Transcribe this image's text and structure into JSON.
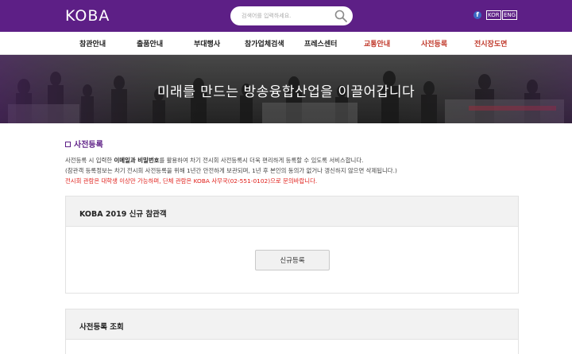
{
  "header": {
    "logo": "KOBA",
    "search_placeholder": "검색어를 입력하세요.",
    "facebook": "f",
    "lang_kor": "KOR",
    "lang_eng": "ENG"
  },
  "nav": [
    {
      "label": "참관안내"
    },
    {
      "label": "출품안내"
    },
    {
      "label": "부대행사"
    },
    {
      "label": "참가업체검색"
    },
    {
      "label": "프레스센터"
    },
    {
      "label": "교통안내"
    },
    {
      "label": "사전등록"
    },
    {
      "label": "전시장도면"
    }
  ],
  "banner": {
    "title": "미래를 만드는 방송융합산업을 이끌어갑니다"
  },
  "section": {
    "title": "사전등록",
    "line1_a": "사전등록 시 입력한 ",
    "line1_b": "이메일과 비밀번호",
    "line1_c": "를 활용하여 차기 전시회 사전등록시 더욱 편리하게 등록할 수 있도록 서비스합니다.",
    "line2": "(참관객 등록정보는 차기 전시회 사전등록을 위해 1년간 안전하게 보관되며, 1년 후 본인의 동의가 없거나 갱신하지 않으면 삭제됩니다.)",
    "line3": "전시회 관람은 대학생 이상만 가능하며, 단체 관람은 KOBA 사무국(02-551-0102)으로 문의바랍니다."
  },
  "panel_new": {
    "title": "KOBA 2019 신규 참관객",
    "button": "신규등록"
  },
  "panel_lookup": {
    "title": "사전등록 조회"
  },
  "colors": {
    "brand": "#5d1f86",
    "highlight_nav": "#c0392b",
    "notice_red": "#e0201b"
  }
}
